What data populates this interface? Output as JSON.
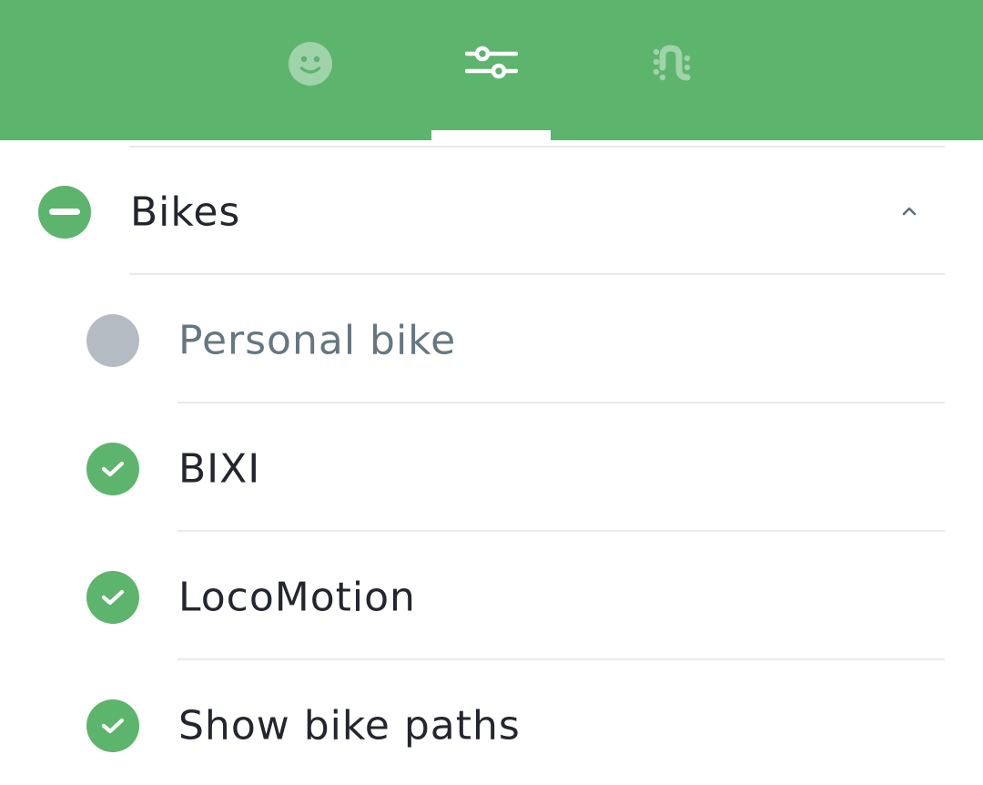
{
  "tabs": [
    {
      "id": "profile",
      "icon": "smiley-face-icon",
      "selected": false
    },
    {
      "id": "filters",
      "icon": "sliders-icon",
      "selected": true
    },
    {
      "id": "routes",
      "icon": "route-icon",
      "selected": false
    }
  ],
  "colors": {
    "accent": "#5db46d",
    "disabled": "#b5bbc2",
    "text": "#23262e",
    "text_muted": "#657780",
    "divider": "#e8eaeb"
  },
  "section": {
    "title": "Bikes",
    "state": "partial",
    "expanded": true
  },
  "items": [
    {
      "label": "Personal bike",
      "checked": false
    },
    {
      "label": "BIXI",
      "checked": true
    },
    {
      "label": "LocoMotion",
      "checked": true
    },
    {
      "label": "Show bike paths",
      "checked": true
    }
  ]
}
